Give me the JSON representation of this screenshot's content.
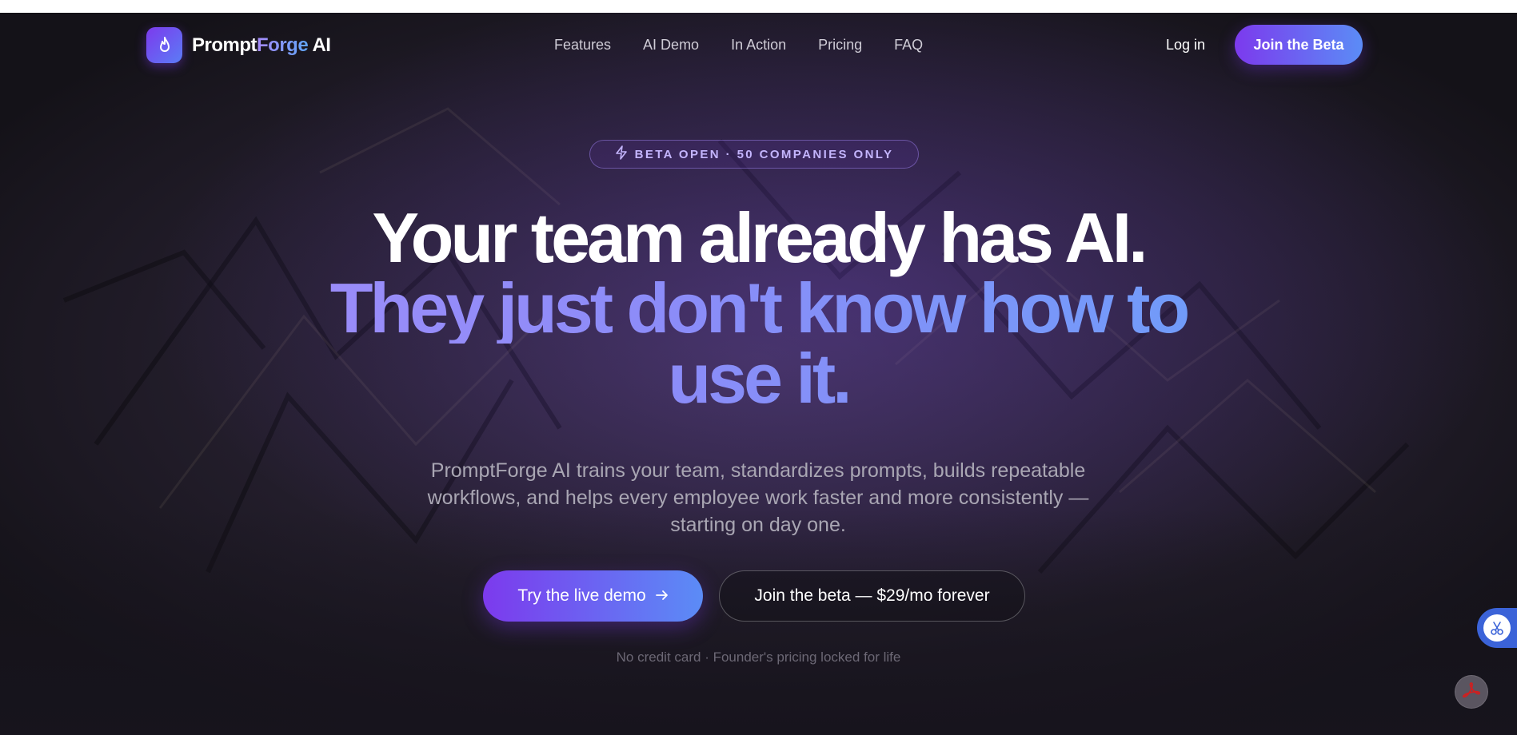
{
  "brand": {
    "name_part1": "Prompt",
    "name_part2": "Forge",
    "name_part3": " AI"
  },
  "nav": {
    "items": [
      {
        "label": "Features"
      },
      {
        "label": "AI Demo"
      },
      {
        "label": "In Action"
      },
      {
        "label": "Pricing"
      },
      {
        "label": "FAQ"
      }
    ],
    "login_label": "Log in",
    "join_label": "Join the Beta"
  },
  "hero": {
    "badge": "BETA OPEN · 50 COMPANIES ONLY",
    "headline_line1": "Your team already has AI.",
    "headline_line2": "They just don't know how to",
    "headline_line3": "use it.",
    "subtitle": "PromptForge AI trains your team, standardizes prompts, builds repeatable workflows, and helps every employee work faster and more consistently — starting on day one.",
    "cta_primary": "Try the live demo",
    "cta_secondary": "Join the beta — $29/mo forever",
    "fineprint": "No credit card · Founder's pricing locked for life"
  },
  "icons": {
    "logo": "flame-icon",
    "badge": "lightning-icon",
    "cta_primary": "arrow-right-icon",
    "widget_1": "scissors-icon",
    "widget_2": "pdf-icon"
  },
  "colors": {
    "accent_purple": "#7c3aed",
    "accent_blue": "#5b8cf6",
    "background": "#17141d"
  }
}
